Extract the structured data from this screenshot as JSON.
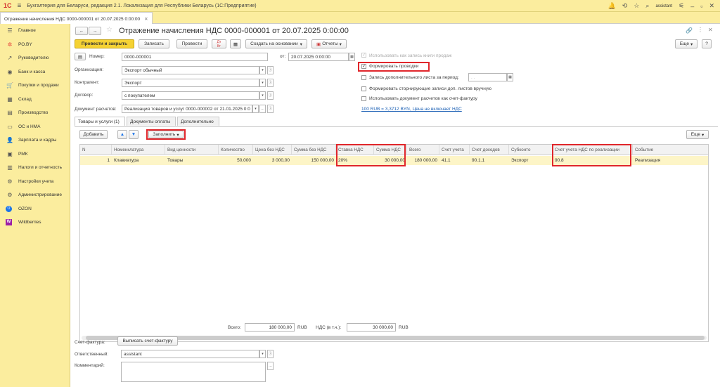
{
  "app": {
    "logo": "1С",
    "title": "Бухгалтерия для Беларуси, редакция 2.1. Локализация для Республики Беларусь  (1С:Предприятие)",
    "user": "assistant"
  },
  "doc_tab": {
    "label": "Отражение начисления НДС 0000-000001 от 20.07.2025 0:00:00"
  },
  "sidebar": {
    "items": [
      {
        "icon": "☰",
        "label": "Главное"
      },
      {
        "icon": "✲",
        "label": "РО.BY"
      },
      {
        "icon": "↗",
        "label": "Руководителю"
      },
      {
        "icon": "◉",
        "label": "Банк и касса"
      },
      {
        "icon": "🛒",
        "label": "Покупки и продажи"
      },
      {
        "icon": "▦",
        "label": "Склад"
      },
      {
        "icon": "▤",
        "label": "Производство"
      },
      {
        "icon": "▭",
        "label": "ОС и НМА"
      },
      {
        "icon": "👤",
        "label": "Зарплата и кадры"
      },
      {
        "icon": "▣",
        "label": "РМК"
      },
      {
        "icon": "▥",
        "label": "Налоги и отчетность"
      },
      {
        "icon": "⚙",
        "label": "Настройки учета"
      },
      {
        "icon": "⚙",
        "label": "Администрирование"
      },
      {
        "icon": "O",
        "label": "OZON"
      },
      {
        "icon": "W",
        "label": "Wildberries"
      }
    ]
  },
  "header": {
    "title": "Отражение начисления НДС 0000-000001 от 20.07.2025 0:00:00",
    "more_label": "Еще",
    "help_label": "?"
  },
  "toolbar": {
    "post_close": "Провести и закрыть",
    "save": "Записать",
    "post": "Провести",
    "create_based": "Создать на основании",
    "reports": "Отчеты",
    "more": "Еще"
  },
  "form": {
    "number_label": "Номер:",
    "number_value": "0000-000001",
    "date_label": "от:",
    "date_value": "20.07.2025  0:00:00",
    "org_label": "Организация:",
    "org_value": "Экспорт обычный",
    "counterparty_label": "Контрагент:",
    "counterparty_value": "Экспорт",
    "contract_label": "Договор:",
    "contract_value": "с покупателем",
    "settlement_label": "Документ расчетов:",
    "settlement_value": "Реализация товаров и услуг 0000-000002 от 21.01.2025 0:0"
  },
  "options": {
    "use_book": "Использовать как запись книги продаж",
    "form_entries": "Формировать проводки",
    "extra_sheet": "Запись дополнительного листа за период:",
    "extra_sheet_date": " .  .    ",
    "storno": "Формировать сторнирующие записи доп. листов вручную",
    "use_invoice": "Использовать документ расчетов как счет-фактуру",
    "rate_link": "100 RUB = 3,3712 BYN, Цена не включает НДС"
  },
  "tabs": [
    {
      "label": "Товары и услуги (1)"
    },
    {
      "label": "Документы оплаты"
    },
    {
      "label": "Дополнительно"
    }
  ],
  "table_toolbar": {
    "add": "Добавить",
    "fill": "Заполнить",
    "more": "Еще"
  },
  "table": {
    "columns": [
      "N",
      "Номенклатура",
      "Вид ценности",
      "Количество",
      "Цена без НДС",
      "Сумма без НДС",
      "Ставка НДС",
      "Сумма НДС",
      "Всего",
      "Счет учета",
      "Счет доходов",
      "Субконто",
      "Счет учета НДС по реализации",
      "Событие"
    ],
    "rows": [
      [
        "1",
        "Клавиатура",
        "Товары",
        "50,000",
        "3 000,00",
        "150 000,00",
        "20%",
        "30 000,00",
        "180 000,00",
        "41.1",
        "90.1.1",
        "Экспорт",
        "90.8",
        "Реализация"
      ]
    ]
  },
  "totals": {
    "total_label": "Всего:",
    "total_value": "180 000,00",
    "currency": "RUB",
    "vat_label": "НДС (в т.ч.):",
    "vat_value": "30 000,00",
    "vat_currency": "RUB"
  },
  "footer": {
    "invoice_label": "Счет-фактура:",
    "invoice_button": "Выписать счет-фактуру",
    "responsible_label": "Ответственный:",
    "responsible_value": "assistant",
    "comment_label": "Комментарий:"
  },
  "colors": {
    "accent": "#f5d232",
    "sidebar": "#fbed9e",
    "highlight": "#e0262b",
    "selected_row": "#fdf5c7"
  }
}
